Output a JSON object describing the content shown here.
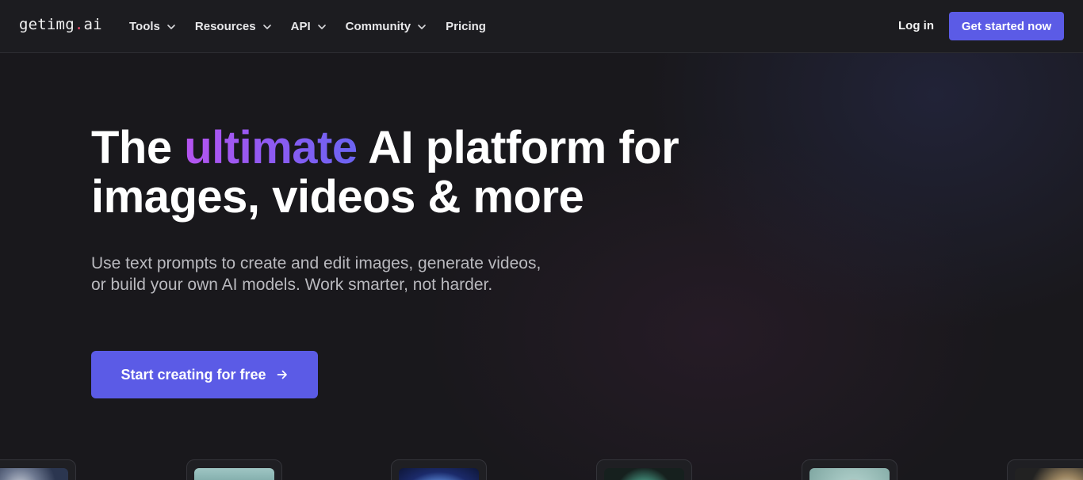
{
  "nav": {
    "logo_main": "getimg",
    "logo_dot": ".",
    "logo_tail": "ai",
    "menu": [
      {
        "label": "Tools",
        "has_dropdown": true
      },
      {
        "label": "Resources",
        "has_dropdown": true
      },
      {
        "label": "API",
        "has_dropdown": true
      },
      {
        "label": "Community",
        "has_dropdown": true
      },
      {
        "label": "Pricing",
        "has_dropdown": false
      }
    ],
    "login_label": "Log in",
    "cta_label": "Get started now"
  },
  "hero": {
    "title_pre": "The",
    "title_accent": "ultimate",
    "title_post": "AI platform for",
    "title_line2": "images, videos & more",
    "subtitle": "Use text prompts to create and edit images, generate videos, or build your own AI models. Work smarter, not harder.",
    "cta_label": "Start creating for free"
  },
  "colors": {
    "accent": "#5b5be6",
    "logo_dot": "#ef4b6a",
    "background": "#19181c"
  },
  "thumbnails": [
    {
      "name": "thumbnail-1"
    },
    {
      "name": "thumbnail-2"
    },
    {
      "name": "thumbnail-3"
    },
    {
      "name": "thumbnail-4"
    },
    {
      "name": "thumbnail-5"
    },
    {
      "name": "thumbnail-6"
    }
  ]
}
